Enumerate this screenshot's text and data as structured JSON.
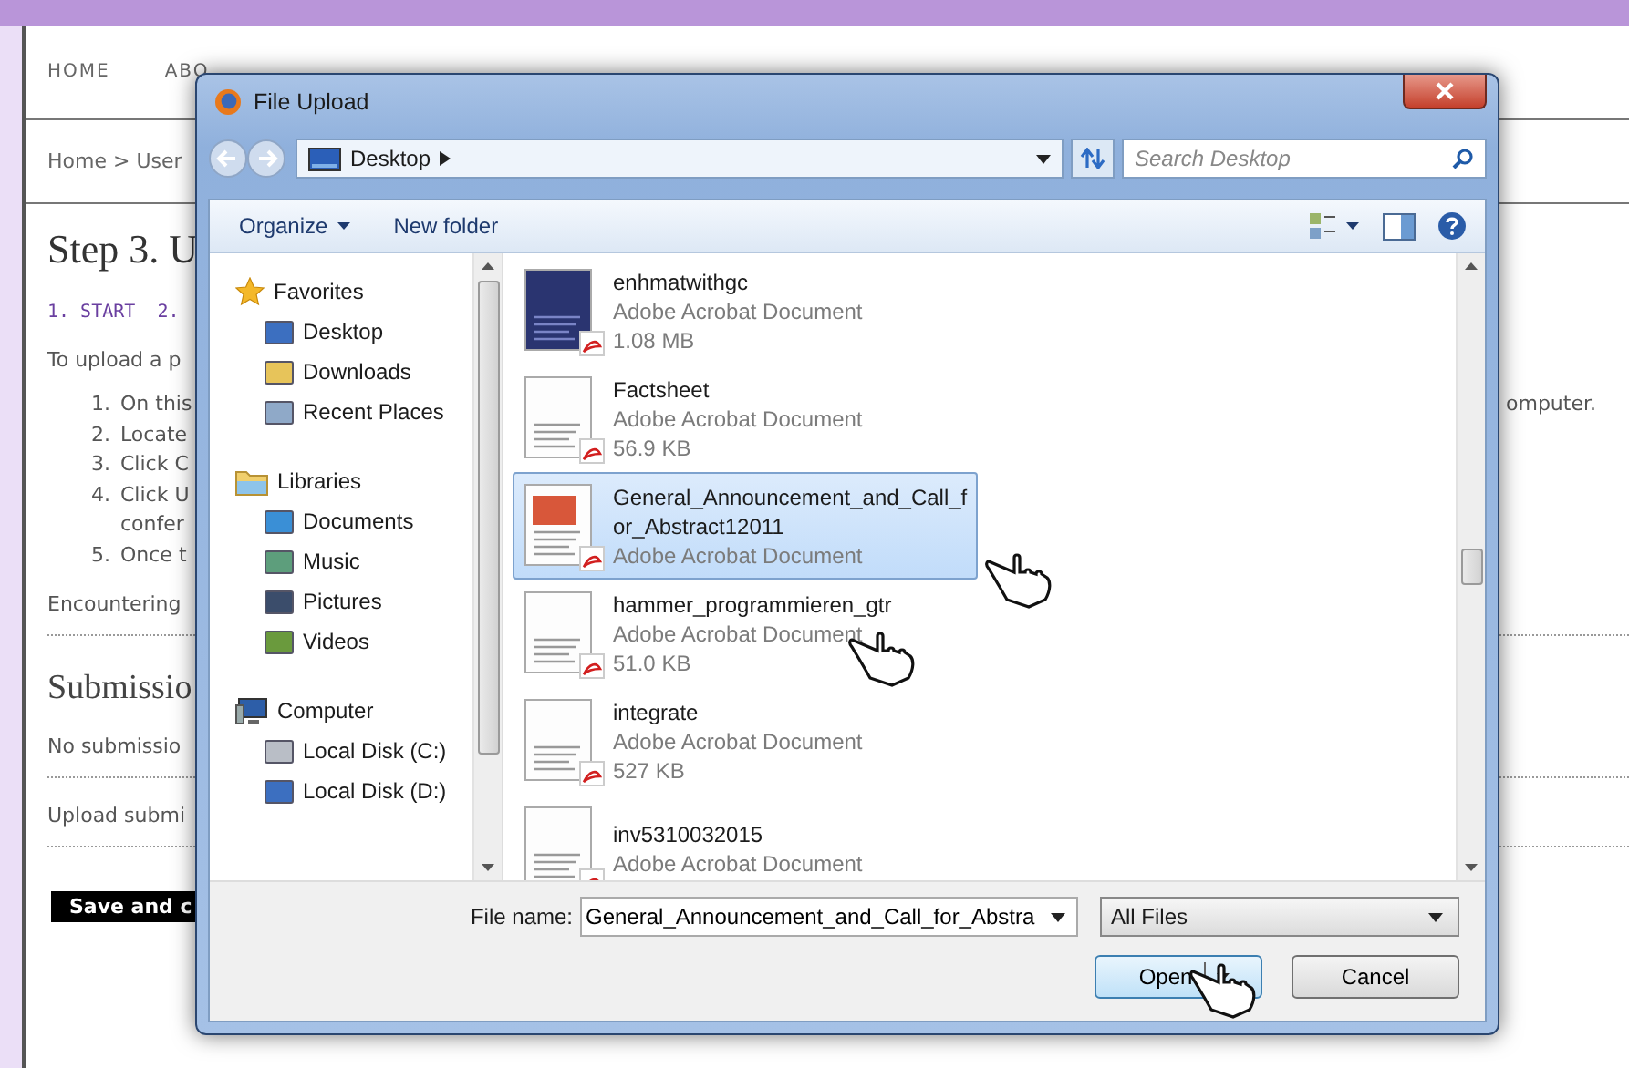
{
  "page": {
    "nav": [
      "HOME",
      "ABO"
    ],
    "breadcrumb": "Home > User",
    "heading": "Step 3. U",
    "steps": "1. START  2.",
    "intro": "To upload a p",
    "list": [
      {
        "number": "1.",
        "lines": [
          "On this"
        ],
        "trailing": "omputer."
      },
      {
        "number": "2.",
        "lines": [
          "Locate"
        ]
      },
      {
        "number": "3.",
        "lines": [
          "Click C"
        ]
      },
      {
        "number": "4.",
        "lines": [
          "Click U",
          "confer"
        ]
      },
      {
        "number": "5.",
        "lines": [
          "Once t"
        ]
      }
    ],
    "help": "Encountering",
    "section_title": "Submissio",
    "no_submissions": "No submissio",
    "upload_label": "Upload submi",
    "save_button": "Save and c"
  },
  "dialog": {
    "title": "File Upload",
    "address": "Desktop",
    "search_placeholder": "Search Desktop",
    "toolbar": [
      "Organize",
      "New folder"
    ],
    "nav": [
      {
        "label": "Favorites",
        "children": [
          "Desktop",
          "Downloads",
          "Recent Places"
        ]
      },
      {
        "label": "Libraries",
        "children": [
          "Documents",
          "Music",
          "Pictures",
          "Videos"
        ]
      },
      {
        "label": "Computer",
        "children": [
          "Local Disk (C:)",
          "Local Disk (D:)"
        ]
      }
    ],
    "files": [
      {
        "name": "enhmatwithgc",
        "type": "Adobe Acrobat Document",
        "size": "1.08 MB",
        "selected": false
      },
      {
        "name": "Factsheet",
        "type": "Adobe Acrobat Document",
        "size": "56.9 KB",
        "selected": false
      },
      {
        "name": "General_Announcement_and_Call_for_Abstract12011",
        "type": "Adobe Acrobat Document",
        "selected": true
      },
      {
        "name": "hammer_programmieren_gtr",
        "type": "Adobe Acrobat Document",
        "size": "51.0 KB",
        "selected": false
      },
      {
        "name": "integrate",
        "type": "Adobe Acrobat Document",
        "size": "527 KB",
        "selected": false
      },
      {
        "name": "inv5310032015",
        "type": "Adobe Acrobat Document",
        "selected": false
      }
    ],
    "file_name_label": "File name:",
    "file_name": "General_Announcement_and_Call_for_Abstra",
    "file_type": "All Files",
    "buttons": [
      "Open",
      "Cancel"
    ]
  }
}
